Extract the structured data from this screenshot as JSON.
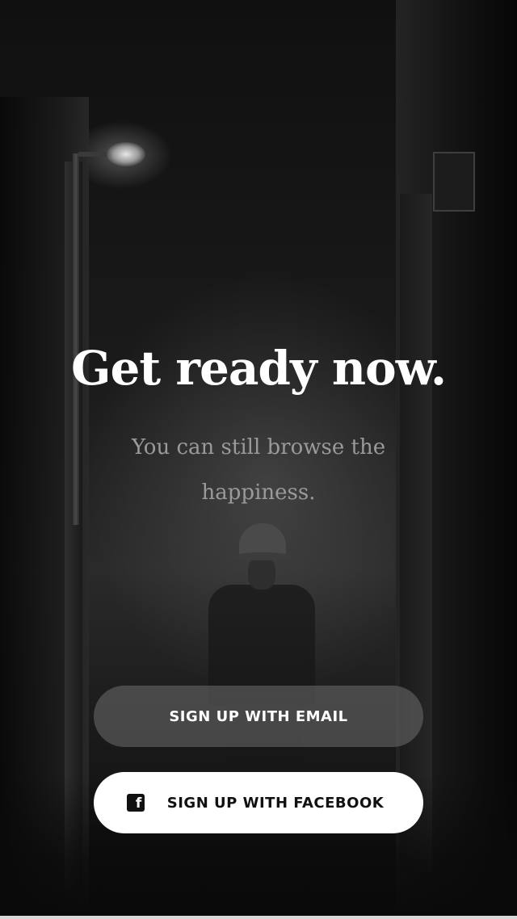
{
  "hero": {
    "headline": "Get ready now.",
    "subheadline": "You can still browse the happiness."
  },
  "actions": {
    "email_label": "SIGN UP WITH EMAIL",
    "facebook_label": "SIGN UP WITH FACEBOOK",
    "facebook_icon": "facebook-icon",
    "facebook_glyph": "f"
  },
  "colors": {
    "headline": "#ffffff",
    "subheadline": "#9a9a9a",
    "email_button_bg": "rgba(110,110,110,0.55)",
    "facebook_button_bg": "#ffffff"
  }
}
